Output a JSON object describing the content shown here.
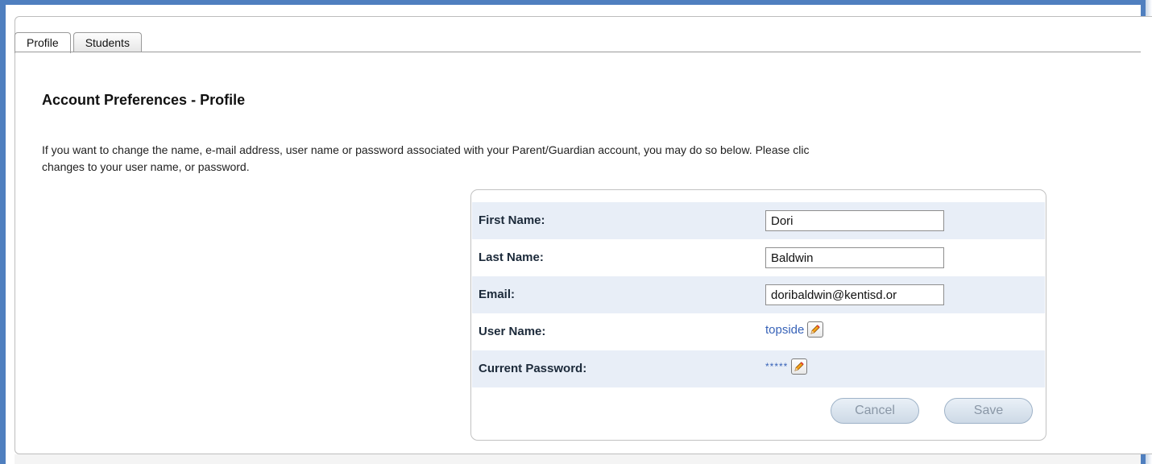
{
  "tabs": [
    {
      "label": "Profile",
      "active": true
    },
    {
      "label": "Students",
      "active": false
    }
  ],
  "page": {
    "title": "Account Preferences - Profile",
    "intro_line1": "If you want to change the name, e-mail address, user name or password associated with your Parent/Guardian account, you may do so below. Please clic",
    "intro_line2": "changes to your user name, or password."
  },
  "form": {
    "first_name": {
      "label": "First Name:",
      "value": "Dori"
    },
    "last_name": {
      "label": "Last Name:",
      "value": "Baldwin"
    },
    "email": {
      "label": "Email:",
      "value": "doribaldwin@kentisd.or"
    },
    "user_name": {
      "label": "User Name:",
      "value": "topside",
      "icon": "edit-pencil-icon"
    },
    "password": {
      "label": "Current Password:",
      "value": "*****",
      "icon": "edit-pencil-icon"
    }
  },
  "buttons": {
    "cancel_label": "Cancel",
    "save_label": "Save"
  },
  "colors": {
    "frame": "#4f7fbf",
    "row_shade": "#e8eef7",
    "link": "#3863b8"
  }
}
